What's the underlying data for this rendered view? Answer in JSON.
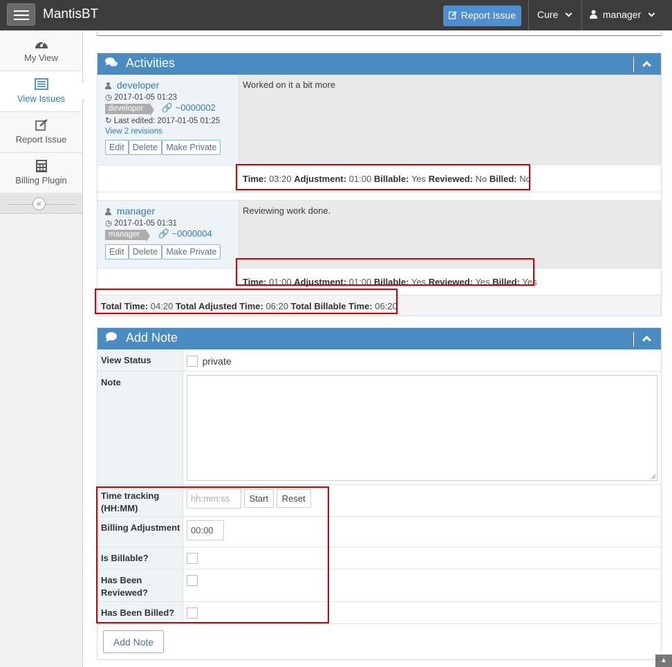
{
  "navbar": {
    "brand": "MantisBT",
    "report_issue_label": "Report Issue",
    "project_label": "Cure",
    "user_label": "manager"
  },
  "sidebar": {
    "items": [
      {
        "label": "My View",
        "icon": "dashboard-icon"
      },
      {
        "label": "View Issues",
        "icon": "list-icon",
        "active": true
      },
      {
        "label": "Report Issue",
        "icon": "edit-icon"
      },
      {
        "label": "Billing Plugin",
        "icon": "calculator-icon"
      }
    ],
    "collapse_symbol": "«"
  },
  "activities": {
    "title": "Activities",
    "notes": [
      {
        "user": "developer",
        "date": "2017-01-05 01:23",
        "role": "developer",
        "note_id": "~0000002",
        "last_edited": "Last edited: 2017-01-05 01:25",
        "revisions_link": "View 2 revisions",
        "text": "Worked on it a bit more",
        "buttons": [
          "Edit",
          "Delete",
          "Make Private"
        ],
        "time": {
          "time_label": "Time:",
          "time_value": "03:20",
          "adj_label": "Adjustment:",
          "adj_value": "01:00",
          "billable_label": "Billable:",
          "billable_value": "Yes",
          "reviewed_label": "Reviewed:",
          "reviewed_value": "No",
          "billed_label": "Billed:",
          "billed_value": "No"
        }
      },
      {
        "user": "manager",
        "date": "2017-01-05 01:31",
        "role": "manager",
        "note_id": "~0000004",
        "text": "Reviewing work done.",
        "buttons": [
          "Edit",
          "Delete",
          "Make Private"
        ],
        "time": {
          "time_label": "Time:",
          "time_value": "01:00",
          "adj_label": "Adjustment:",
          "adj_value": "01:00",
          "billable_label": "Billable:",
          "billable_value": "Yes",
          "reviewed_label": "Reviewed:",
          "reviewed_value": "Yes",
          "billed_label": "Billed:",
          "billed_value": "Yes"
        }
      }
    ],
    "totals": {
      "total_label": "Total Time:",
      "total_value": "04:20",
      "adjusted_label": "Total Adjusted Time:",
      "adjusted_value": "06:20",
      "billable_label": "Total Billable Time:",
      "billable_value": "06:20"
    }
  },
  "add_note": {
    "title": "Add Note",
    "view_status_label": "View Status",
    "private_label": "private",
    "note_label": "Note",
    "time_tracking_label": "Time tracking (HH:MM)",
    "time_placeholder": "hh:mm:ss",
    "start_label": "Start",
    "reset_label": "Reset",
    "billing_adjustment_label": "Billing Adjustment",
    "billing_adjustment_value": "00:00",
    "is_billable_label": "Is Billable?",
    "has_been_reviewed_label": "Has Been Reviewed?",
    "has_been_billed_label": "Has Been Billed?",
    "submit_label": "Add Note"
  },
  "colors": {
    "header_blue": "#4a8bc2",
    "highlight_red": "#d40000",
    "link_blue": "#2b7dbc"
  }
}
